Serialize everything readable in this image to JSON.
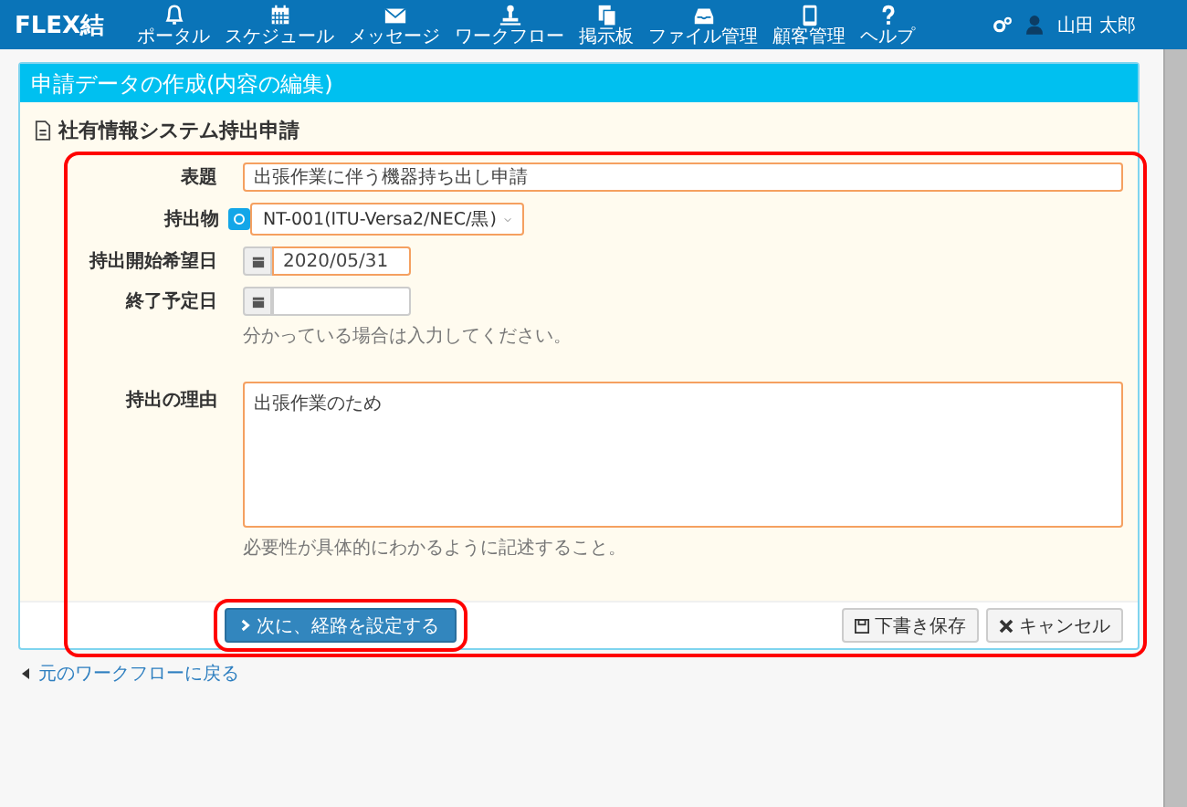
{
  "header": {
    "logo": "FLEX結",
    "nav": [
      {
        "label": "ポータル"
      },
      {
        "label": "スケジュール"
      },
      {
        "label": "メッセージ"
      },
      {
        "label": "ワークフロー"
      },
      {
        "label": "掲示板"
      },
      {
        "label": "ファイル管理"
      },
      {
        "label": "顧客管理"
      },
      {
        "label": "ヘルプ"
      }
    ],
    "user": "山田 太郎"
  },
  "panel": {
    "title": "申請データの作成(内容の編集)",
    "form_title": "社有情報システム持出申請",
    "fields": [
      {
        "kind": "text",
        "label": "表題",
        "value": "出張作業に伴う機器持ち出し申請",
        "required": true
      },
      {
        "kind": "select",
        "label": "持出物",
        "value": "NT-001(ITU-Versa2/NEC/黒)",
        "required": true
      },
      {
        "kind": "date",
        "label": "持出開始希望日",
        "value": "2020/05/31",
        "required": true
      },
      {
        "kind": "date",
        "label": "終了予定日",
        "required": false,
        "hint": "分かっている場合は入力してください。"
      },
      {
        "kind": "textarea",
        "label": "持出の理由",
        "value": "出張作業のため",
        "required": true,
        "hint": "必要性が具体的にわかるように記述すること。"
      }
    ],
    "next_button": "次に、経路を設定する",
    "draft_button": "下書き保存",
    "cancel_button": "キャンセル"
  },
  "back_link": "元のワークフローに戻る"
}
